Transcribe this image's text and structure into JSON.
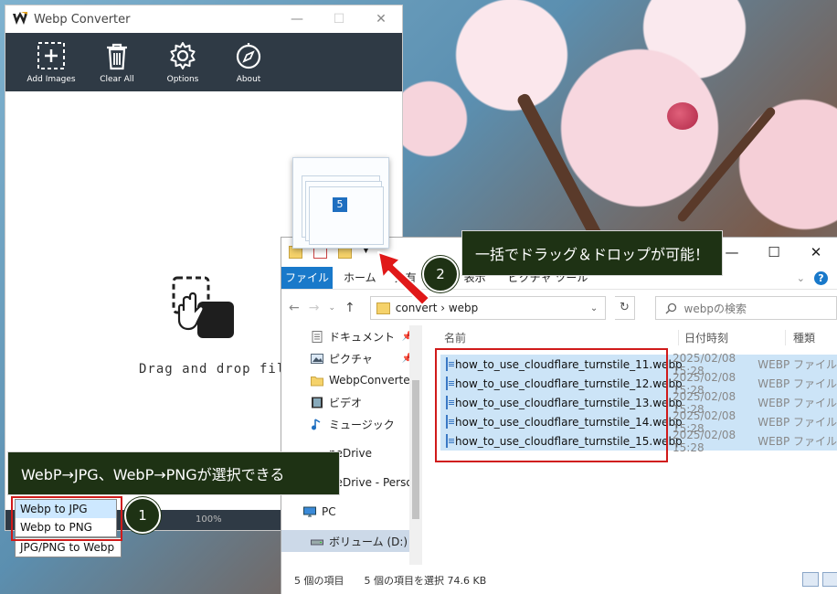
{
  "converter": {
    "title": "Webp Converter",
    "toolbar": [
      {
        "label": "Add Images",
        "icon": "add-images-icon"
      },
      {
        "label": "Clear All",
        "icon": "trash-icon"
      },
      {
        "label": "Options",
        "icon": "gear-icon"
      },
      {
        "label": "About",
        "icon": "compass-icon"
      }
    ],
    "drop_text": "Drag and drop files",
    "progress": "100%",
    "modes": [
      "Webp to JPG",
      "Webp to PNG",
      "JPG/PNG to Webp"
    ],
    "selected_mode": "Webp to JPG",
    "accent": "#2f3a45"
  },
  "thumb_badge": "5",
  "explorer": {
    "tabs": {
      "file": "ファイル",
      "home": "ホーム",
      "share": "共有",
      "view": "表示",
      "tool": "ピクチャ ツール"
    },
    "address": "convert  ›  webp",
    "search_placeholder": "webpの検索",
    "sidebar": [
      {
        "label": "ドキュメント",
        "pinned": true,
        "icon": "document-icon"
      },
      {
        "label": "ピクチャ",
        "pinned": true,
        "icon": "picture-icon"
      },
      {
        "label": "WebpConverter",
        "pinned": false,
        "icon": "folder-icon"
      },
      {
        "label": "ビデオ",
        "pinned": false,
        "icon": "video-icon"
      },
      {
        "label": "ミュージック",
        "pinned": false,
        "icon": "music-icon"
      },
      {
        "label": "neDrive",
        "pinned": false,
        "icon": "cloud-icon"
      },
      {
        "label": "neDrive - Person",
        "pinned": false,
        "icon": "cloud-icon"
      },
      {
        "label": "PC",
        "pinned": false,
        "icon": "pc-icon"
      },
      {
        "label": "ボリューム (D:)",
        "pinned": false,
        "icon": "drive-icon"
      }
    ],
    "columns": {
      "name": "名前",
      "date": "日付時刻",
      "type": "種類"
    },
    "files": [
      {
        "name": "how_to_use_cloudflare_turnstile_11.webp",
        "date": "2025/02/08 15:28",
        "type": "WEBP ファイル"
      },
      {
        "name": "how_to_use_cloudflare_turnstile_12.webp",
        "date": "2025/02/08 15:28",
        "type": "WEBP ファイル"
      },
      {
        "name": "how_to_use_cloudflare_turnstile_13.webp",
        "date": "2025/02/08 15:28",
        "type": "WEBP ファイル"
      },
      {
        "name": "how_to_use_cloudflare_turnstile_14.webp",
        "date": "2025/02/08 15:28",
        "type": "WEBP ファイル"
      },
      {
        "name": "how_to_use_cloudflare_turnstile_15.webp",
        "date": "2025/02/08 15:28",
        "type": "WEBP ファイル"
      }
    ],
    "status_count": "5 個の項目",
    "status_selected": "5 個の項目を選択  74.6 KB"
  },
  "callouts": {
    "step1_num": "1",
    "step1_text": "WebP→JPG、WebP→PNGが選択できる",
    "step2_num": "2",
    "step2_text": "一括でドラッグ＆ドロップが可能！"
  }
}
